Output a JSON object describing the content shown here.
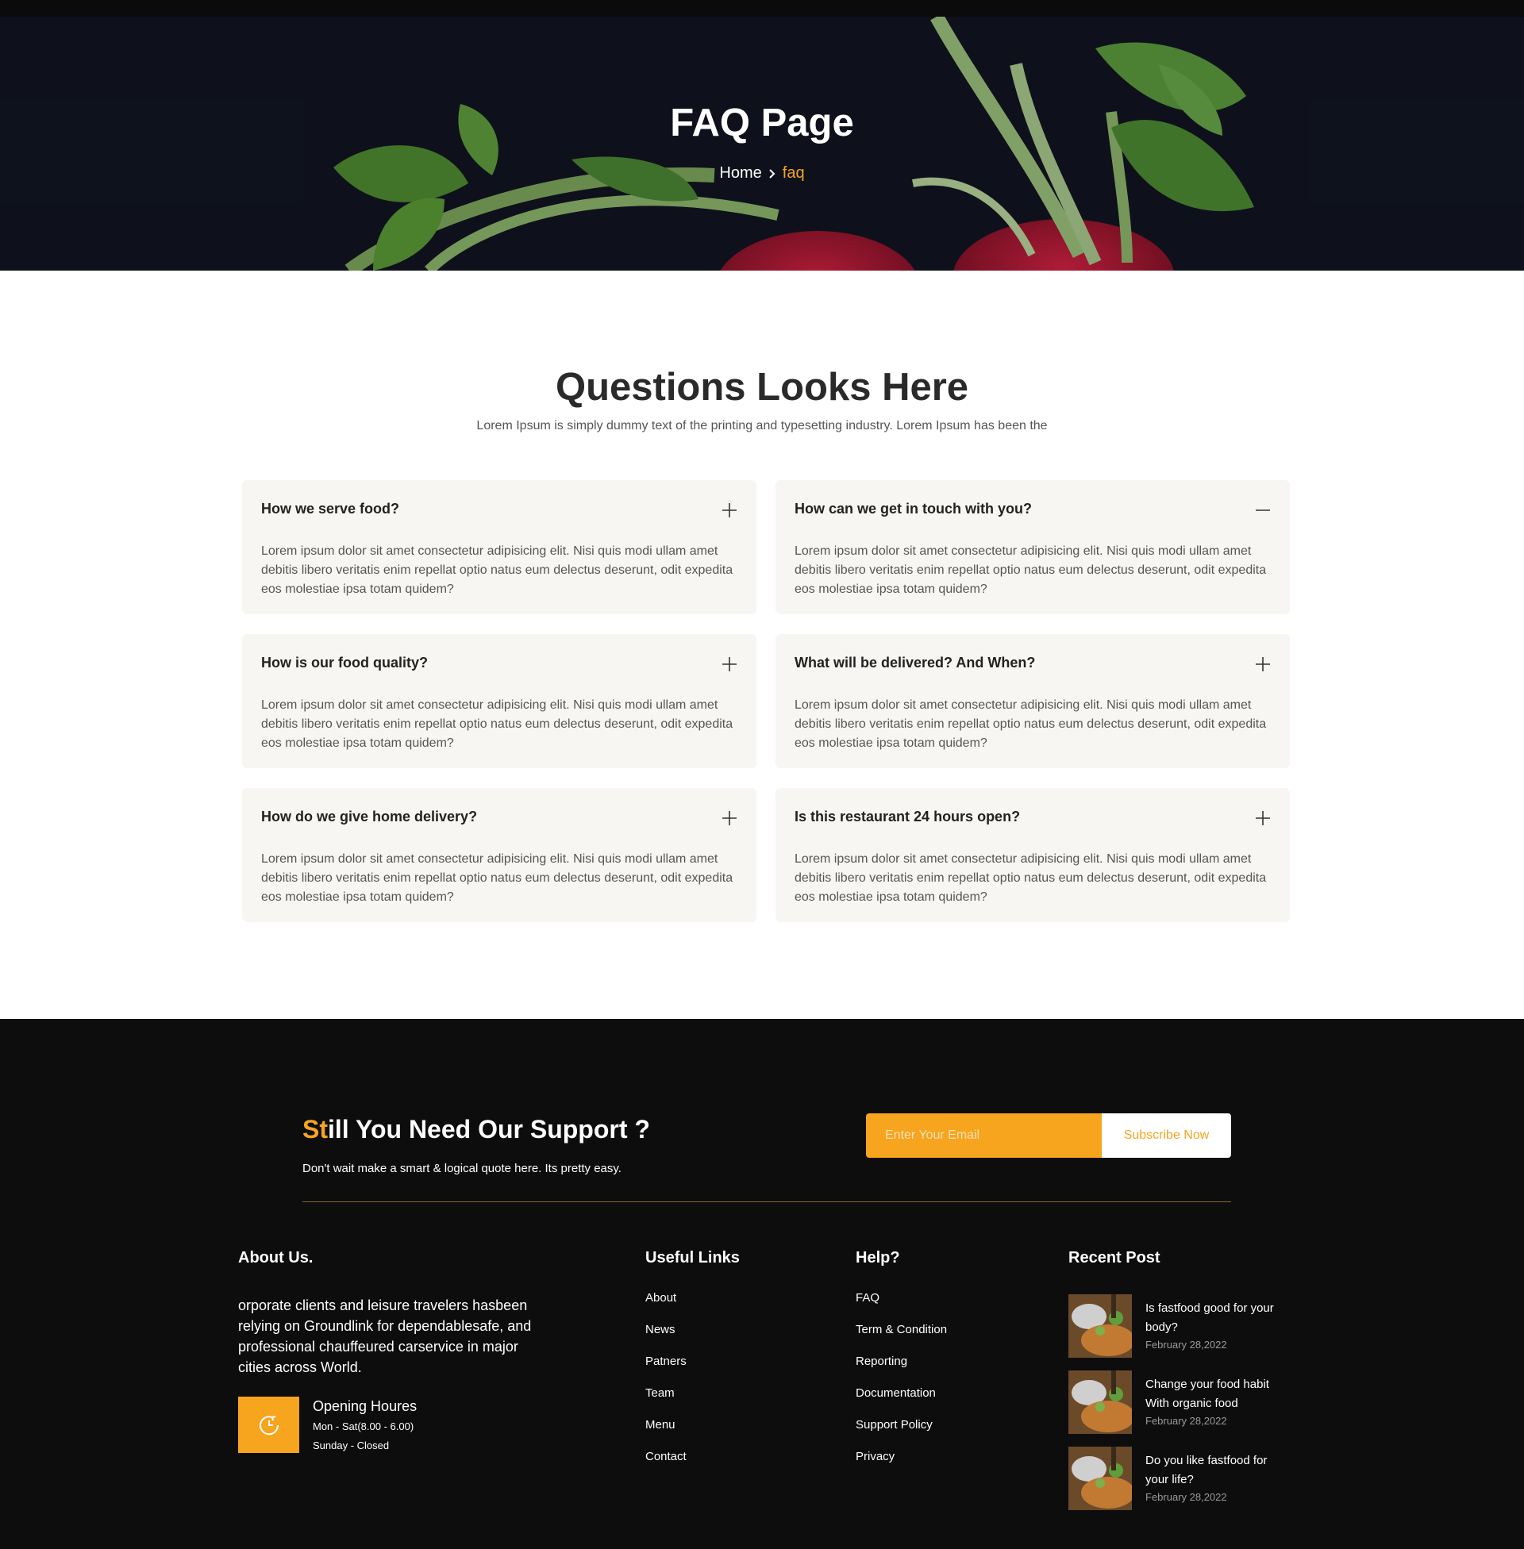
{
  "hero": {
    "title": "FAQ Page",
    "breadcrumb": {
      "home": "Home",
      "current": "faq"
    }
  },
  "faq": {
    "heading": "Questions Looks Here",
    "subheading": "Lorem Ipsum is simply dummy text of the printing and typesetting industry. Lorem Ipsum has been the",
    "items": [
      {
        "question": "How we serve food?",
        "answer": "Lorem ipsum dolor sit amet consectetur adipisicing elit. Nisi quis modi ullam amet debitis libero veritatis enim repellat optio natus eum delectus deserunt, odit expedita eos molestiae ipsa totam quidem?",
        "toggle_icon": "plus-icon",
        "expanded": false
      },
      {
        "question": "How can we get in touch with you?",
        "answer": "Lorem ipsum dolor sit amet consectetur adipisicing elit. Nisi quis modi ullam amet debitis libero veritatis enim repellat optio natus eum delectus deserunt, odit expedita eos molestiae ipsa totam quidem?",
        "toggle_icon": "minus-icon",
        "expanded": true
      },
      {
        "question": "How is our food quality?",
        "answer": "Lorem ipsum dolor sit amet consectetur adipisicing elit. Nisi quis modi ullam amet debitis libero veritatis enim repellat optio natus eum delectus deserunt, odit expedita eos molestiae ipsa totam quidem?",
        "toggle_icon": "plus-icon",
        "expanded": false
      },
      {
        "question": "What will be delivered? And When?",
        "answer": "Lorem ipsum dolor sit amet consectetur adipisicing elit. Nisi quis modi ullam amet debitis libero veritatis enim repellat optio natus eum delectus deserunt, odit expedita eos molestiae ipsa totam quidem?",
        "toggle_icon": "plus-icon",
        "expanded": false
      },
      {
        "question": "How do we give home delivery?",
        "answer": "Lorem ipsum dolor sit amet consectetur adipisicing elit. Nisi quis modi ullam amet debitis libero veritatis enim repellat optio natus eum delectus deserunt, odit expedita eos molestiae ipsa totam quidem?",
        "toggle_icon": "plus-icon",
        "expanded": false
      },
      {
        "question": "Is this restaurant 24 hours open?",
        "answer": "Lorem ipsum dolor sit amet consectetur adipisicing elit. Nisi quis modi ullam amet debitis libero veritatis enim repellat optio natus eum delectus deserunt, odit expedita eos molestiae ipsa totam quidem?",
        "toggle_icon": "plus-icon",
        "expanded": false
      }
    ]
  },
  "support": {
    "title_accent": "St",
    "title_rest": "ill You Need Our Support ?",
    "subtitle": "Don't wait make a smart & logical quote here. Its pretty easy.",
    "email_placeholder": "Enter Your Email",
    "email_value": "",
    "subscribe_label": "Subscribe Now"
  },
  "footer": {
    "about": {
      "title": "About Us.",
      "text": "orporate clients and leisure travelers hasbeen relying on Groundlink for dependablesafe, and professional chauffeured carservice in major cities across World.",
      "hours_icon": "clock-icon",
      "hours_title": "Opening Houres",
      "hours_weekdays": "Mon - Sat(8.00 - 6.00)",
      "hours_sunday": "Sunday - Closed"
    },
    "useful_links": {
      "title": "Useful Links",
      "items": [
        "About",
        "News",
        "Patners",
        "Team",
        "Menu",
        "Contact"
      ]
    },
    "help": {
      "title": "Help?",
      "items": [
        "FAQ",
        "Term & Condition",
        "Reporting",
        "Documentation",
        "Support Policy",
        "Privacy"
      ]
    },
    "recent_posts": {
      "title": "Recent Post",
      "items": [
        {
          "title": "Is fastfood good for your body?",
          "date": "February 28,2022"
        },
        {
          "title": "Change your food habit With organic food",
          "date": "February 28,2022"
        },
        {
          "title": "Do you like fastfood for your life?",
          "date": "February 28,2022"
        }
      ]
    }
  },
  "colors": {
    "accent": "#f7a41f",
    "footer_bg": "#0d0d0d",
    "card_bg": "#f8f6f2",
    "hero_bg": "#0f131d"
  }
}
